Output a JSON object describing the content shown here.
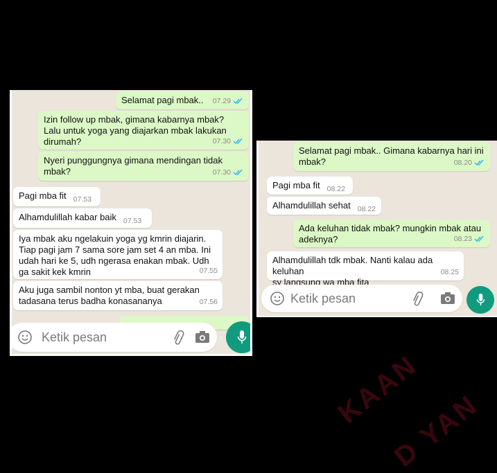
{
  "left_chat": {
    "messages": [
      {
        "dir": "out",
        "text": "Selamat pagi mbak..",
        "time": "07.29"
      },
      {
        "dir": "out",
        "text": "Izin follow up mbak, gimana kabarnya mbak?\nLalu untuk yoga yang diajarkan mbak lakukan\ndirumah?",
        "time": "07.30"
      },
      {
        "dir": "out",
        "text": "Nyeri punggungnya gimana mendingan tidak\nmbak?",
        "time": "07.30"
      },
      {
        "dir": "in",
        "text": "Pagi mba fit",
        "time": "07.53"
      },
      {
        "dir": "in",
        "text": "Alhamdulillah kabar baik",
        "time": "07.53"
      },
      {
        "dir": "in",
        "text": "Iya mbak aku ngelakuin yoga yg kmrin diajarin.\nTiap pagi jam 7 sama sore jam set 4 an mba. Ini\nudah hari ke 5, udh ngerasa enakan mbak. Udh\nga sakit kek kmrin",
        "time": "07.55"
      },
      {
        "dir": "in",
        "text": "Aku juga sambil nonton yt mba, buat gerakan\ntadasana terus badha konasananya",
        "time": "07.56"
      }
    ],
    "input_placeholder": "Ketik pesan"
  },
  "right_chat": {
    "messages": [
      {
        "dir": "out",
        "text": "Selamat pagi mbak.. Gimana kabarnya hari ini\nmbak?",
        "time": "08.20"
      },
      {
        "dir": "in",
        "text": "Pagi mba fit",
        "time": "08.22"
      },
      {
        "dir": "in",
        "text": "Alhamdulillah sehat",
        "time": "08.22"
      },
      {
        "dir": "out",
        "text": "Ada keluhan tidak mbak? mungkin mbak atau\nadeknya?",
        "time": "08.23"
      },
      {
        "dir": "in",
        "text": "Alhamdulillah tdk mbak. Nanti kalau ada keluhan\nsy langsung wa mba fita",
        "emoji": "😊",
        "time": "08.25"
      }
    ],
    "input_placeholder": "Ketik pesan"
  },
  "icons": [
    "double-check-icon",
    "emoji-icon",
    "paperclip-icon",
    "camera-icon",
    "microphone-icon"
  ],
  "colors": {
    "outgoing": "#dcf8c6",
    "incoming": "#ffffff",
    "background": "#ebe5dc",
    "tick_read": "#34b7f1",
    "mic": "#109b7e"
  }
}
